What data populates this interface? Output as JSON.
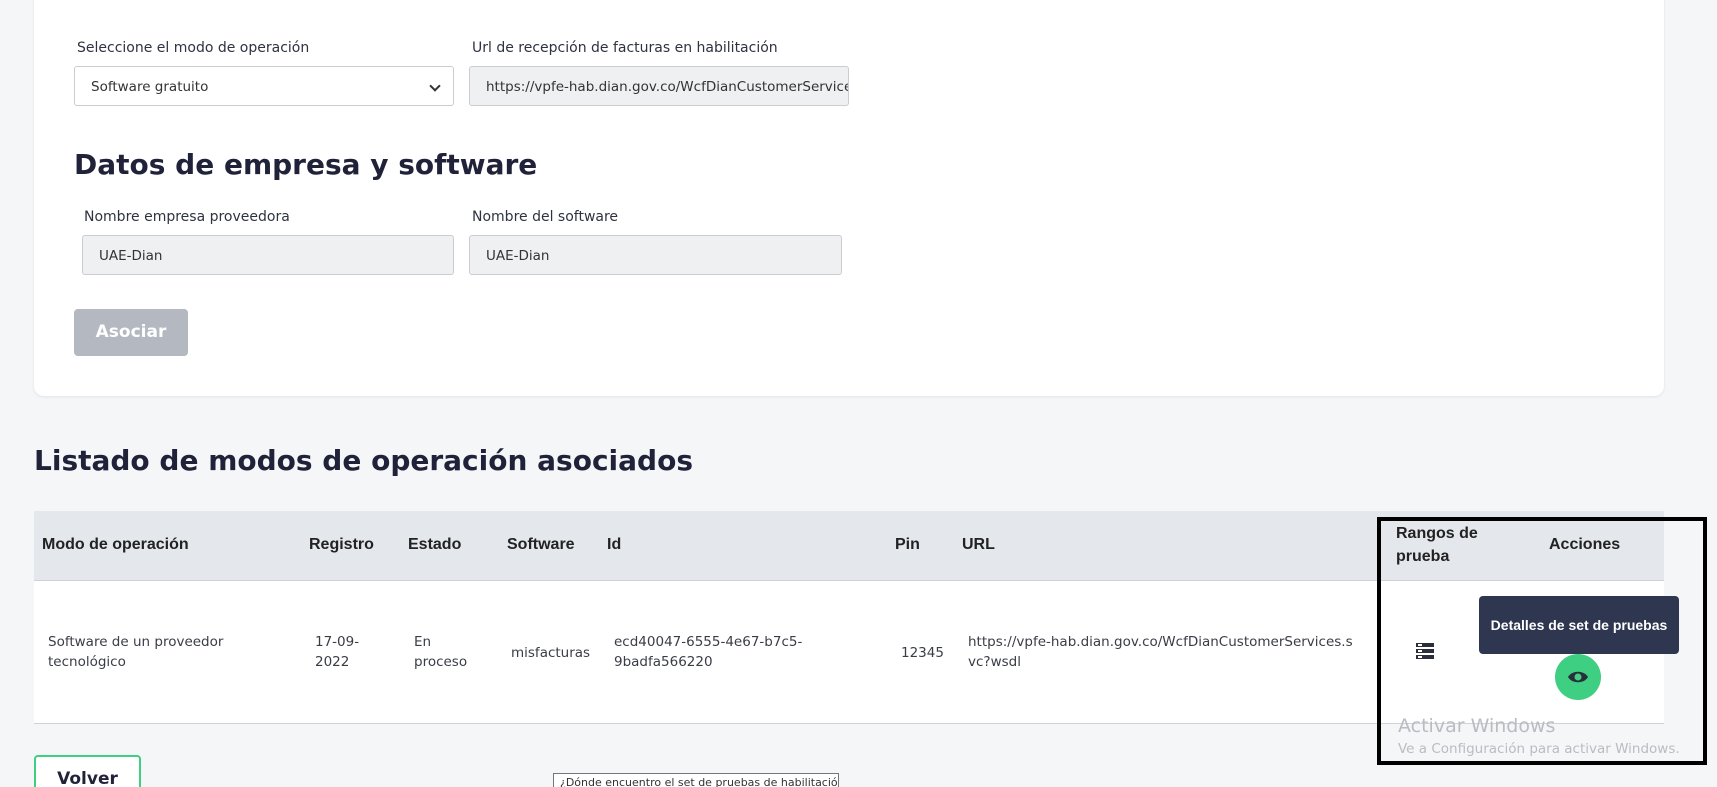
{
  "form": {
    "mode_label": "Seleccione el modo de operación",
    "mode_value": "Software gratuito",
    "url_label": "Url de recepción de facturas en habilitación",
    "url_value": "https://vpfe-hab.dian.gov.co/WcfDianCustomerService",
    "company_section_title": "Datos de empresa y software",
    "provider_label": "Nombre empresa proveedora",
    "provider_value": "UAE-Dian",
    "software_label": "Nombre del software",
    "software_value": "UAE-Dian",
    "associate_button": "Asociar"
  },
  "list": {
    "title": "Listado de modos de operación asociados",
    "columns": {
      "mode": "Modo de operación",
      "registro": "Registro",
      "estado": "Estado",
      "software": "Software",
      "id": "Id",
      "pin": "Pin",
      "url": "URL",
      "rangos": "Rangos de prueba",
      "acciones": "Acciones"
    },
    "row": {
      "mode": "Software de un proveedor tecnológico",
      "registro": "17-09-2022",
      "estado": "En proceso",
      "software": "misfacturas",
      "id": "ecd40047-6555-4e67-b7c5-9badfa566220",
      "pin": "12345",
      "url": "https://vpfe-hab.dian.gov.co/WcfDianCustomerServices.svc?wsdl"
    },
    "tooltip": "Detalles de set de pruebas"
  },
  "icons": {
    "range": "list-ranges-icon",
    "eye": "eye-icon"
  },
  "watermark": {
    "title": "Activar Windows",
    "subtitle": "Ve a Configuración para activar Windows."
  },
  "footer": {
    "back_button": "Volver",
    "help_link": "¿Dónde encuentro el set de pruebas de habilitación"
  },
  "colors": {
    "accent": "#3ecf82",
    "disabled": "#b3b8c1",
    "tooltip_bg": "#2f3650",
    "heading": "#1f2238"
  }
}
